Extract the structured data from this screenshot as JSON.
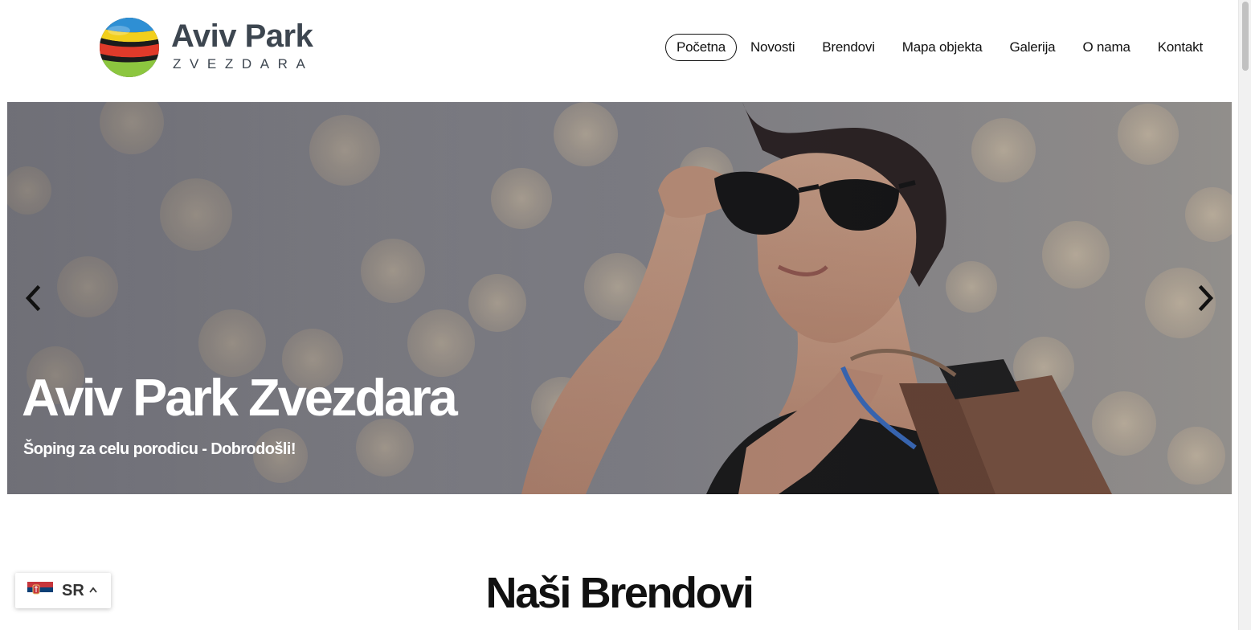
{
  "logo": {
    "title": "Aviv Park",
    "subtitle": "ZVEZDARA"
  },
  "nav": {
    "items": [
      {
        "label": "Početna",
        "active": true
      },
      {
        "label": "Novosti",
        "active": false
      },
      {
        "label": "Brendovi",
        "active": false
      },
      {
        "label": "Mapa objekta",
        "active": false
      },
      {
        "label": "Galerija",
        "active": false
      },
      {
        "label": "O nama",
        "active": false
      },
      {
        "label": "Kontakt",
        "active": false
      }
    ]
  },
  "hero": {
    "title": "Aviv Park Zvezdara",
    "subtitle": "Šoping za celu porodicu - Dobrodošli!",
    "prev_icon": "chevron-left-icon",
    "next_icon": "chevron-right-icon"
  },
  "section": {
    "heading": "Naši Brendovi"
  },
  "language": {
    "code": "SR",
    "flag_icon": "serbia-flag-icon",
    "caret_icon": "chevron-up-icon"
  },
  "colors": {
    "text": "#111111",
    "logo_text": "#3d4650",
    "hero_text": "#ffffff"
  }
}
